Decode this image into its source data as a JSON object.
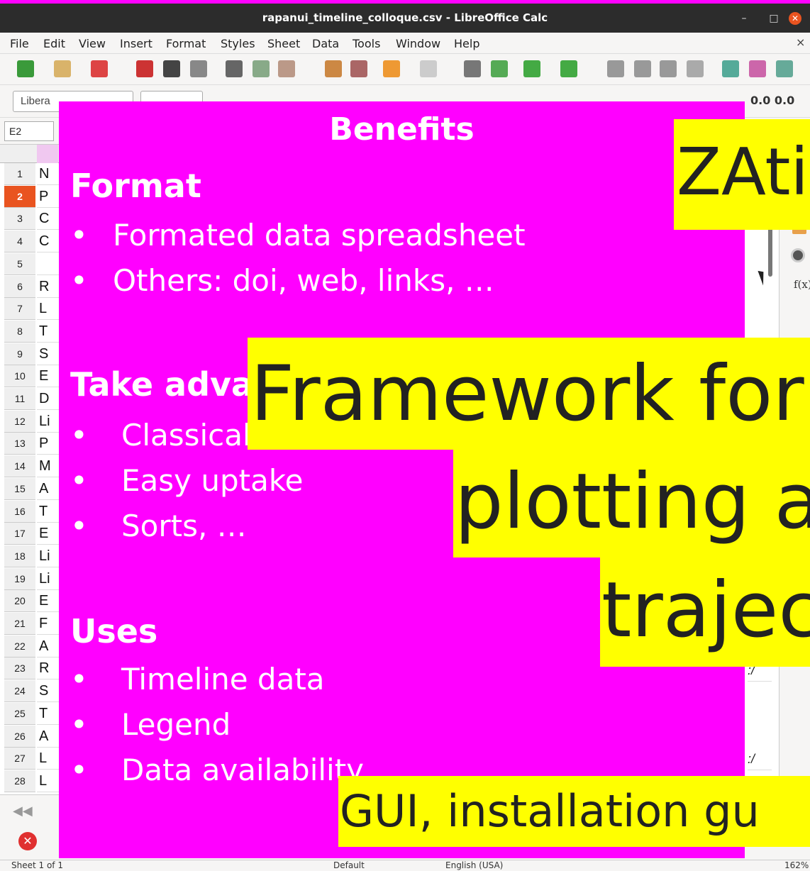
{
  "window": {
    "title": "rapanui_timeline_colloque.csv - LibreOffice Calc",
    "min": "–",
    "max": "□",
    "close": "✕"
  },
  "menu": {
    "items": [
      "File",
      "Edit",
      "View",
      "Insert",
      "Format",
      "Styles",
      "Sheet",
      "Data",
      "Tools",
      "Window",
      "Help"
    ],
    "close": "×"
  },
  "toolbar": {
    "font_name": "Libera",
    "format_icons": "0.0  0.0"
  },
  "formula": {
    "name_box": "E2"
  },
  "rows": {
    "numbers": [
      "1",
      "2",
      "3",
      "4",
      "5",
      "6",
      "7",
      "8",
      "9",
      "10",
      "11",
      "12",
      "13",
      "14",
      "15",
      "16",
      "17",
      "18",
      "19",
      "20",
      "21",
      "22",
      "23",
      "24",
      "25",
      "26",
      "27",
      "28"
    ],
    "colA": [
      "N",
      "P",
      "C",
      "C",
      "",
      "R",
      "L",
      "T",
      "S",
      "E",
      "D",
      "Li",
      "P",
      "M",
      "A",
      "T",
      "E",
      "Li",
      "Li",
      "E",
      "F",
      "A",
      "R",
      "S",
      "T",
      "A",
      "L",
      "L"
    ]
  },
  "right_cells": [
    ":/",
    ":/",
    ":/"
  ],
  "sidebar": {
    "fx": "f(x)"
  },
  "status": {
    "sheet": "Sheet 1 of 1",
    "style": "Default",
    "lang": "English (USA)",
    "zoom": "162%"
  },
  "slide": {
    "title": "Benefits",
    "sections": [
      {
        "heading": "Format",
        "bullets": [
          "Formated data spreadsheet",
          "Others: doi, web, links, …"
        ]
      },
      {
        "heading": "Take adva",
        "bullets": [
          "Classical",
          "Easy uptake",
          "Sorts, …"
        ]
      },
      {
        "heading": "Uses",
        "bullets": [
          "Timeline data",
          "Legend",
          "Data availability"
        ]
      }
    ],
    "bullet_char": "•"
  },
  "overlays": {
    "zati": "ZAti",
    "framework": "Framework for",
    "plotting": "plotting a",
    "trajec": "trajec",
    "gui": "GUI, installation gu"
  }
}
